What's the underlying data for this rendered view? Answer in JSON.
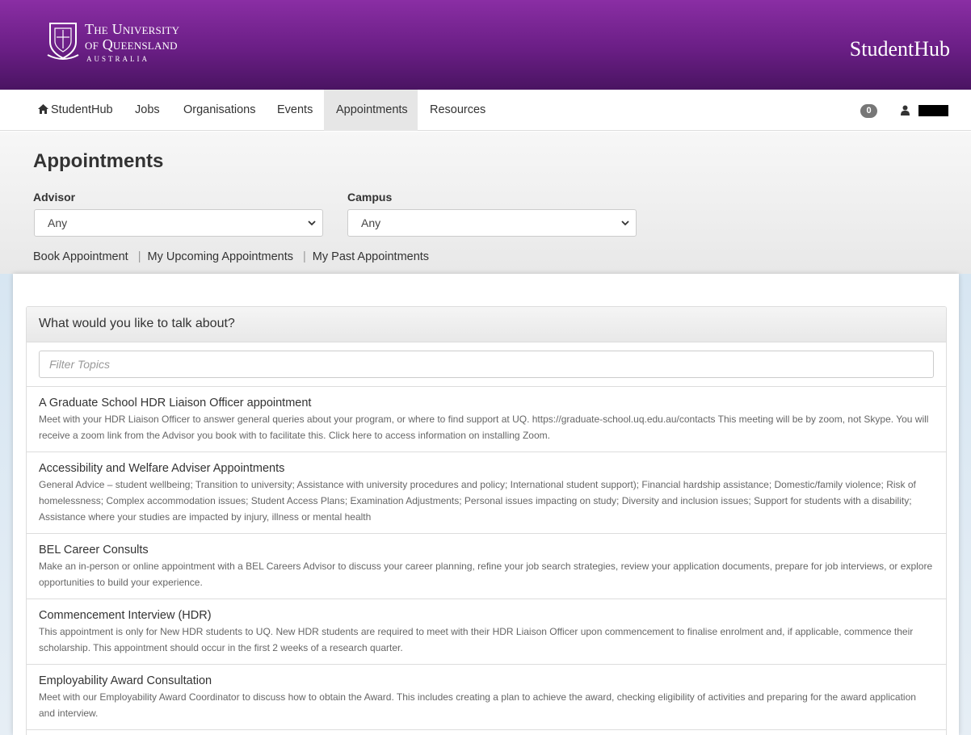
{
  "header": {
    "logo_line1": "The University",
    "logo_line2": "of Queensland",
    "logo_line3": "AUSTRALIA",
    "brand": "StudentHub"
  },
  "nav": {
    "items": [
      {
        "label": "StudentHub",
        "icon": "home-icon"
      },
      {
        "label": "Jobs"
      },
      {
        "label": "Organisations"
      },
      {
        "label": "Events"
      },
      {
        "label": "Appointments",
        "active": true
      },
      {
        "label": "Resources"
      }
    ],
    "notification_count": "0",
    "user_icon": "user-icon"
  },
  "page": {
    "title": "Appointments",
    "advisor_label": "Advisor",
    "advisor_value": "Any",
    "campus_label": "Campus",
    "campus_value": "Any",
    "sublinks": [
      "Book Appointment",
      "My Upcoming Appointments",
      "My Past Appointments"
    ],
    "separator": "|"
  },
  "panel": {
    "heading": "What would you like to talk about?",
    "filter_placeholder": "Filter Topics",
    "topics": [
      {
        "title": "A Graduate School HDR Liaison Officer appointment",
        "description": "Meet with your HDR Liaison Officer to answer general queries about your program, or where to find support at UQ. https://graduate-school.uq.edu.au/contacts This meeting will be by zoom, not Skype. You will receive a zoom link from the Advisor you book with to facilitate this. Click here to access information on installing Zoom."
      },
      {
        "title": "Accessibility and Welfare Adviser Appointments",
        "description": "General Advice – student wellbeing; Transition to university; Assistance with university procedures and policy; International student support); Financial hardship assistance; Domestic/family violence; Risk of homelessness; Complex accommodation issues; Student Access Plans; Examination Adjustments; Personal issues impacting on study; Diversity and inclusion issues; Support for students with a disability; Assistance where your studies are impacted by injury, illness or mental health"
      },
      {
        "title": "BEL Career Consults",
        "description": "Make an in-person or online appointment with a BEL Careers Advisor to discuss your career planning, refine your job search strategies, review your application documents, prepare for job interviews, or explore opportunities to build your experience."
      },
      {
        "title": "Commencement Interview (HDR)",
        "description": "This appointment is only for New HDR students to UQ. New HDR students are required to meet with their HDR Liaison Officer upon commencement to finalise enrolment and, if applicable, commence their scholarship. This appointment should occur in the first 2 weeks of a research quarter."
      },
      {
        "title": "Employability Award Consultation",
        "description": "Meet with our Employability Award Coordinator to discuss how to obtain the Award. This includes creating a plan to achieve the award, checking eligibility of activities and preparing for the award application and interview."
      }
    ]
  },
  "colors": {
    "header_purple": "#6a1e85",
    "active_tab": "#e6e6e6",
    "badge": "#777777"
  }
}
